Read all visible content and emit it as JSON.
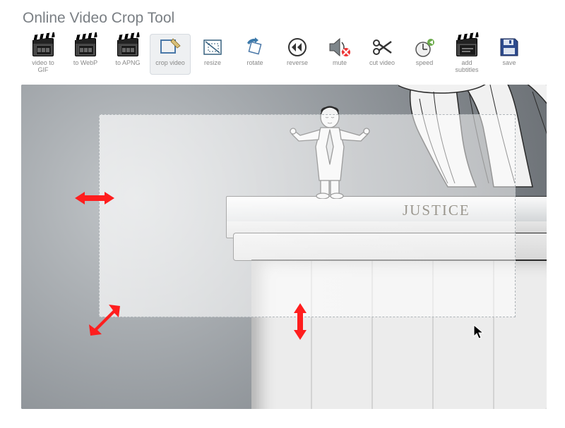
{
  "title": "Online Video Crop Tool",
  "toolbar": {
    "items": [
      {
        "label": "video to\nGIF"
      },
      {
        "label": "to WebP"
      },
      {
        "label": "to APNG"
      },
      {
        "label": "crop video"
      },
      {
        "label": "resize"
      },
      {
        "label": "rotate"
      },
      {
        "label": "reverse"
      },
      {
        "label": "mute"
      },
      {
        "label": "cut video"
      },
      {
        "label": "speed"
      },
      {
        "label": "add\nsubtitles"
      },
      {
        "label": "save"
      }
    ],
    "active_index": 3
  },
  "canvas": {
    "inscription": "JUSTICE",
    "arrows": [
      "horizontal",
      "diagonal",
      "vertical"
    ]
  }
}
